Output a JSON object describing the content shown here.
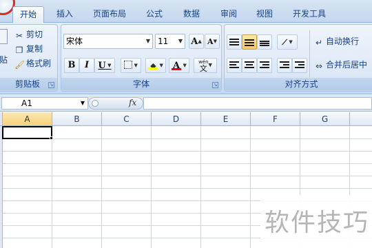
{
  "tabs": [
    "开始",
    "插入",
    "页面布局",
    "公式",
    "数据",
    "审阅",
    "视图",
    "开发工具"
  ],
  "active_tab": "开始",
  "clipboard": {
    "paste_label": "贴",
    "cut": "剪切",
    "copy": "复制",
    "format_painter": "格式刷",
    "group_label": "剪贴板"
  },
  "font": {
    "name": "宋体",
    "size": "11",
    "grow": "A",
    "shrink": "A",
    "bold": "B",
    "italic": "I",
    "underline": "U",
    "font_color_letter": "A",
    "phonetic_top": "wén",
    "phonetic_char": "文",
    "group_label": "字体",
    "colors": {
      "fill": "#ffff00",
      "font": "#ff0000"
    }
  },
  "alignment": {
    "wrap_text": "自动换行",
    "merge_center": "合并后居中",
    "group_label": "对齐方式"
  },
  "formula_bar": {
    "name_box": "A1",
    "fx": "fx",
    "formula": ""
  },
  "columns": [
    "A",
    "B",
    "C",
    "D",
    "E",
    "F",
    "G"
  ],
  "active_column": "A",
  "watermark": "软件技巧"
}
